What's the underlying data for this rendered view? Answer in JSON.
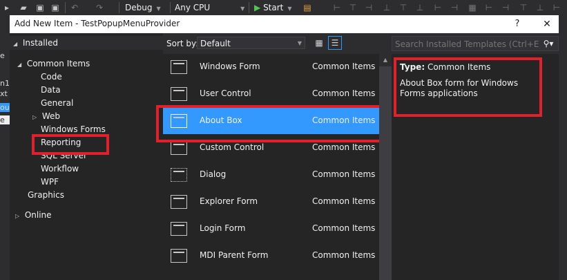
{
  "toolbar": {
    "config": "Debug",
    "platform": "Any CPU",
    "start": "Start"
  },
  "background_fragments": [
    "e",
    "n1",
    "xt",
    "ou",
    "e"
  ],
  "dialog": {
    "title": "Add New Item - TestPopupMenuProvider",
    "help": "?",
    "close": "✕"
  },
  "tree": {
    "installed": "Installed",
    "common_items": "Common Items",
    "children": [
      "Code",
      "Data",
      "General",
      "Web",
      "Windows Forms",
      "Reporting",
      "SQL Server",
      "Workflow",
      "WPF"
    ],
    "graphics": "Graphics",
    "online": "Online"
  },
  "sort": {
    "label": "Sort by:",
    "value": "Default"
  },
  "templates": [
    {
      "name": "Windows Form",
      "category": "Common Items"
    },
    {
      "name": "User Control",
      "category": "Common Items"
    },
    {
      "name": "About Box",
      "category": "Common Items"
    },
    {
      "name": "Custom Control",
      "category": "Common Items"
    },
    {
      "name": "Dialog",
      "category": "Common Items"
    },
    {
      "name": "Explorer Form",
      "category": "Common Items"
    },
    {
      "name": "Login Form",
      "category": "Common Items"
    },
    {
      "name": "MDI Parent Form",
      "category": "Common Items"
    }
  ],
  "search": {
    "placeholder": "Search Installed Templates (Ctrl+E)"
  },
  "details": {
    "type_label": "Type:",
    "type_value": "Common Items",
    "description": "About Box form for Windows Forms applications"
  },
  "colors": {
    "selection": "#3399ff",
    "annotation": "#e0202b"
  }
}
